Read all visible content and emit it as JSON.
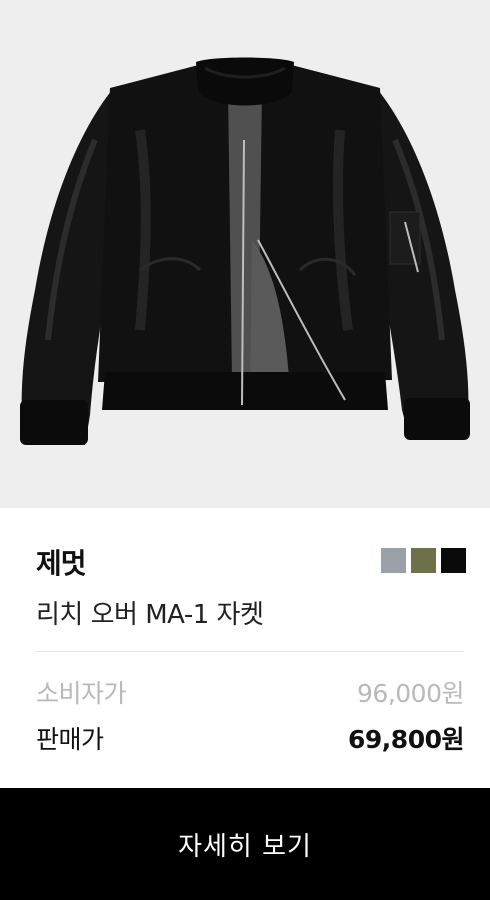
{
  "product": {
    "image_alt": "black MA-1 bomber jacket",
    "brand": "제멋",
    "name": "리치 오버 MA-1 자켓",
    "swatches": [
      {
        "name": "gray",
        "color": "#9aa0a8"
      },
      {
        "name": "olive",
        "color": "#6e7049"
      },
      {
        "name": "black",
        "color": "#0a0a0a"
      }
    ],
    "list_price_label": "소비자가",
    "list_price": "96,000원",
    "sale_price_label": "판매가",
    "sale_price": "69,800원"
  },
  "actions": {
    "detail_button_label": "자세히 보기"
  },
  "colors": {
    "image_background": "#eeeeee",
    "button_background": "#000000",
    "muted_text": "#b9b9b9"
  }
}
